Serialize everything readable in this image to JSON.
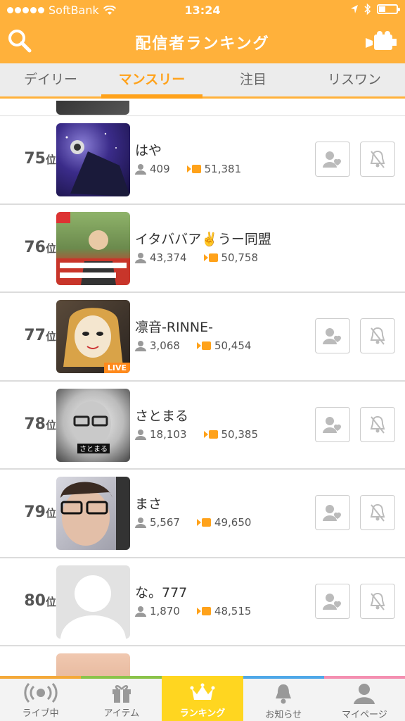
{
  "status_bar": {
    "carrier": "SoftBank",
    "time": "13:24"
  },
  "header": {
    "title": "配信者ランキング"
  },
  "tabs": [
    {
      "label": "デイリー",
      "active": false
    },
    {
      "label": "マンスリー",
      "active": true
    },
    {
      "label": "注目",
      "active": false
    },
    {
      "label": "リスワン",
      "active": false
    }
  ],
  "rankings": [
    {
      "rank": "75",
      "rank_unit": "位",
      "name": "はや",
      "followers": "409",
      "points": "51,381",
      "live": false,
      "show_actions": true
    },
    {
      "rank": "76",
      "rank_unit": "位",
      "name": "イタババア✌️うー同盟",
      "followers": "43,374",
      "points": "50,758",
      "live": false,
      "show_actions": false
    },
    {
      "rank": "77",
      "rank_unit": "位",
      "name": "凛音-RINNE-",
      "followers": "3,068",
      "points": "50,454",
      "live": true,
      "live_label": "LIVE",
      "show_actions": true
    },
    {
      "rank": "78",
      "rank_unit": "位",
      "name": "さとまる",
      "followers": "18,103",
      "points": "50,385",
      "live": false,
      "show_actions": true,
      "avatar_caption": "さとまる"
    },
    {
      "rank": "79",
      "rank_unit": "位",
      "name": "まさ",
      "followers": "5,567",
      "points": "49,650",
      "live": false,
      "show_actions": true
    },
    {
      "rank": "80",
      "rank_unit": "位",
      "name": "な。777",
      "followers": "1,870",
      "points": "48,515",
      "live": false,
      "show_actions": true
    }
  ],
  "bottom_nav": [
    {
      "label": "ライブ中",
      "icon": "live-broadcast-icon",
      "color": "#F4A93A",
      "active": false
    },
    {
      "label": "アイテム",
      "icon": "gift-icon",
      "color": "#8BC34A",
      "active": false
    },
    {
      "label": "ランキング",
      "icon": "crown-icon",
      "color": "#FFD620",
      "active": true
    },
    {
      "label": "お知らせ",
      "icon": "bell-icon",
      "color": "#4FA8E8",
      "active": false
    },
    {
      "label": "マイページ",
      "icon": "person-icon",
      "color": "#F48FB1",
      "active": false
    }
  ],
  "colors": {
    "brand": "#FFB13B",
    "accent": "#FFA21A",
    "active_nav": "#FFD620"
  }
}
